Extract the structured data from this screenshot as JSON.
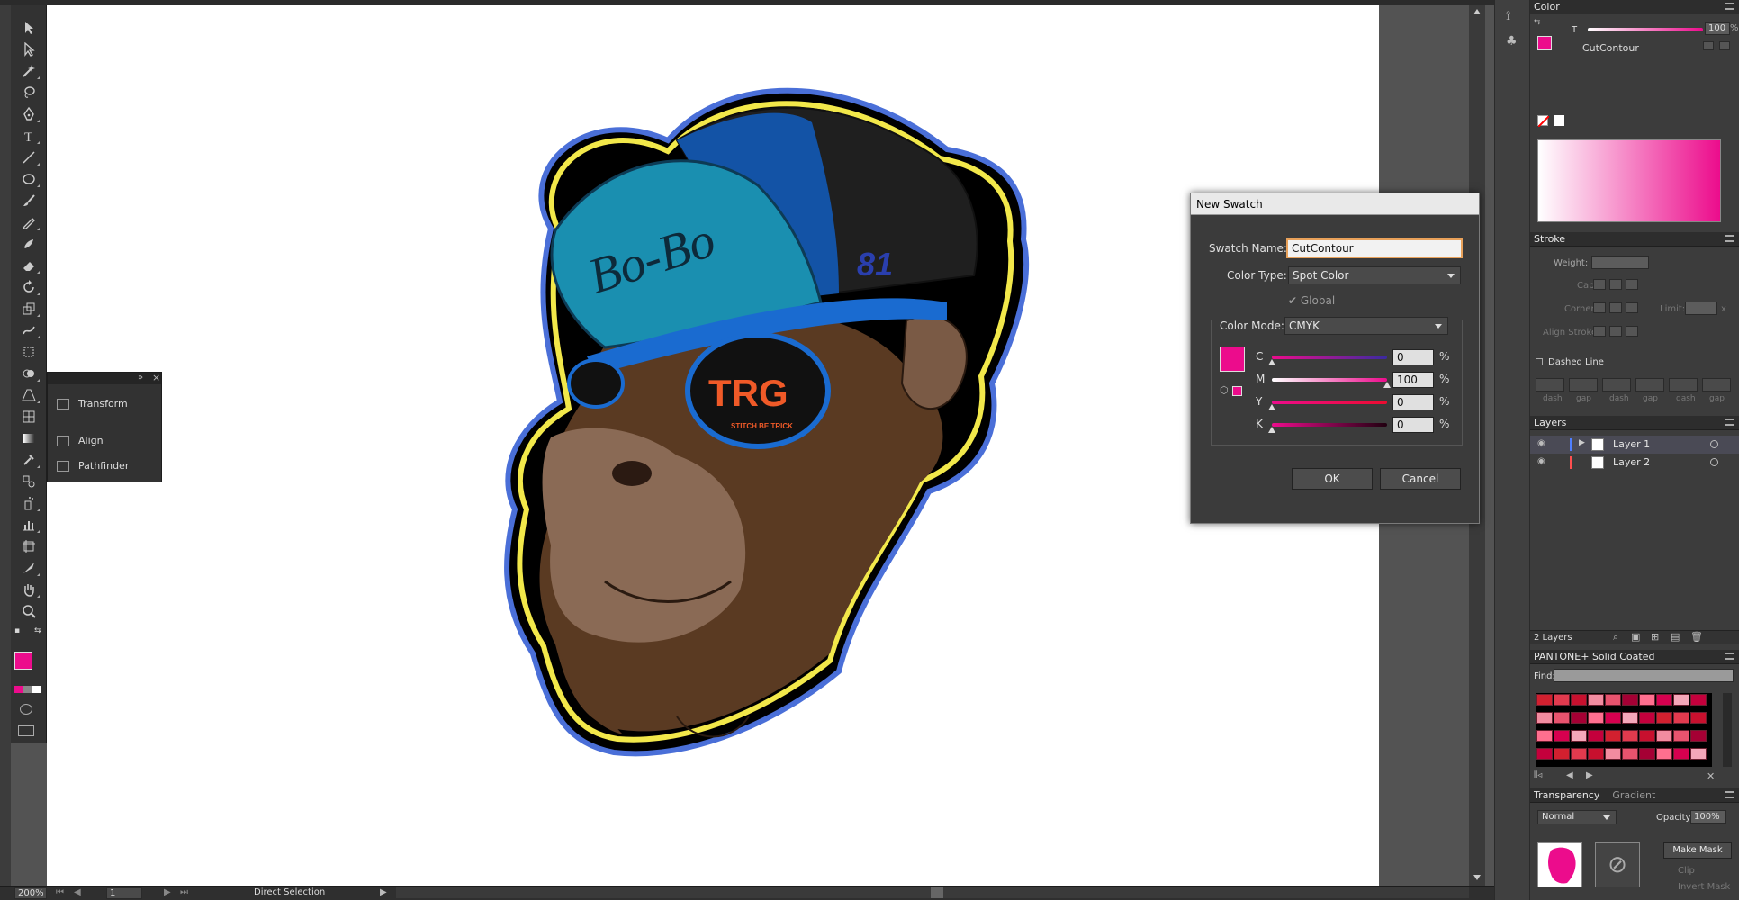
{
  "app": {
    "accent": "#ec0c8c"
  },
  "toolbar": {
    "tools": [
      "selection-icon",
      "direct-selection-icon",
      "magic-wand-icon",
      "lasso-icon",
      "pen-icon",
      "type-icon",
      "line-icon",
      "ellipse-icon",
      "paintbrush-icon",
      "pencil-icon",
      "blob-brush-icon",
      "eraser-icon",
      "rotate-icon",
      "scale-icon",
      "warp-icon",
      "free-transform-icon",
      "shape-builder-icon",
      "perspective-icon",
      "mesh-icon",
      "gradient-icon",
      "eyedropper-icon",
      "blend-icon",
      "symbol-sprayer-icon",
      "graph-icon",
      "artboard-icon",
      "slice-icon",
      "hand-icon",
      "zoom-icon"
    ]
  },
  "float_panel": {
    "items": [
      {
        "label": "Transform",
        "icon": "transform-icon"
      },
      {
        "label": "Align",
        "icon": "align-icon"
      },
      {
        "label": "Pathfinder",
        "icon": "pathfinder-icon"
      }
    ]
  },
  "dialog": {
    "title": "New Swatch",
    "swatch_name_label": "Swatch Name:",
    "swatch_name_value": "CutContour",
    "color_type_label": "Color Type:",
    "color_type_value": "Spot Color",
    "global_label": "Global",
    "color_mode_label": "Color Mode:",
    "color_mode_value": "CMYK",
    "channels": [
      {
        "label": "C",
        "value": "0",
        "fraction": 0.0
      },
      {
        "label": "M",
        "value": "100",
        "fraction": 1.0
      },
      {
        "label": "Y",
        "value": "0",
        "fraction": 0.0
      },
      {
        "label": "K",
        "value": "0",
        "fraction": 0.0
      }
    ],
    "percent": "%",
    "ok_label": "OK",
    "cancel_label": "Cancel",
    "preview_color": "#ec0c8c"
  },
  "color_panel": {
    "title": "Color",
    "tint_label": "T",
    "tint_value": "100",
    "percent": "%",
    "swatch_name": "CutContour"
  },
  "stroke_panel": {
    "title": "Stroke",
    "weight_label": "Weight:",
    "cap_label": "Cap:",
    "corner_label": "Corner:",
    "limit_label": "Limit:",
    "limit_unit": "x",
    "align_label": "Align Stroke:",
    "dashed_label": "Dashed Line",
    "dash_labels": [
      "dash",
      "gap",
      "dash",
      "gap",
      "dash",
      "gap"
    ]
  },
  "layers_panel": {
    "title": "Layers",
    "layers": [
      {
        "name": "Layer 1",
        "color": "#4f7fff"
      },
      {
        "name": "Layer 2",
        "color": "#ff4f4f"
      }
    ],
    "count_label": "2 Layers"
  },
  "swatch_library": {
    "title": "PANTONE+ Solid Coated",
    "find_label": "Find:"
  },
  "transparency_panel": {
    "tabs": [
      "Transparency",
      "Gradient"
    ],
    "blend_mode": "Normal",
    "opacity_label": "Opacity:",
    "opacity_value": "100%",
    "make_mask": "Make Mask",
    "clip": "Clip",
    "invert_mask": "Invert Mask"
  },
  "statusbar": {
    "zoom": "200%",
    "artboard": "1",
    "tool_name": "Direct Selection"
  },
  "artwork": {
    "cap_text": "Bo-Bo",
    "cap_number": "81",
    "lens_text": "TRG",
    "lens_sub": "STITCH BE TRICK"
  }
}
